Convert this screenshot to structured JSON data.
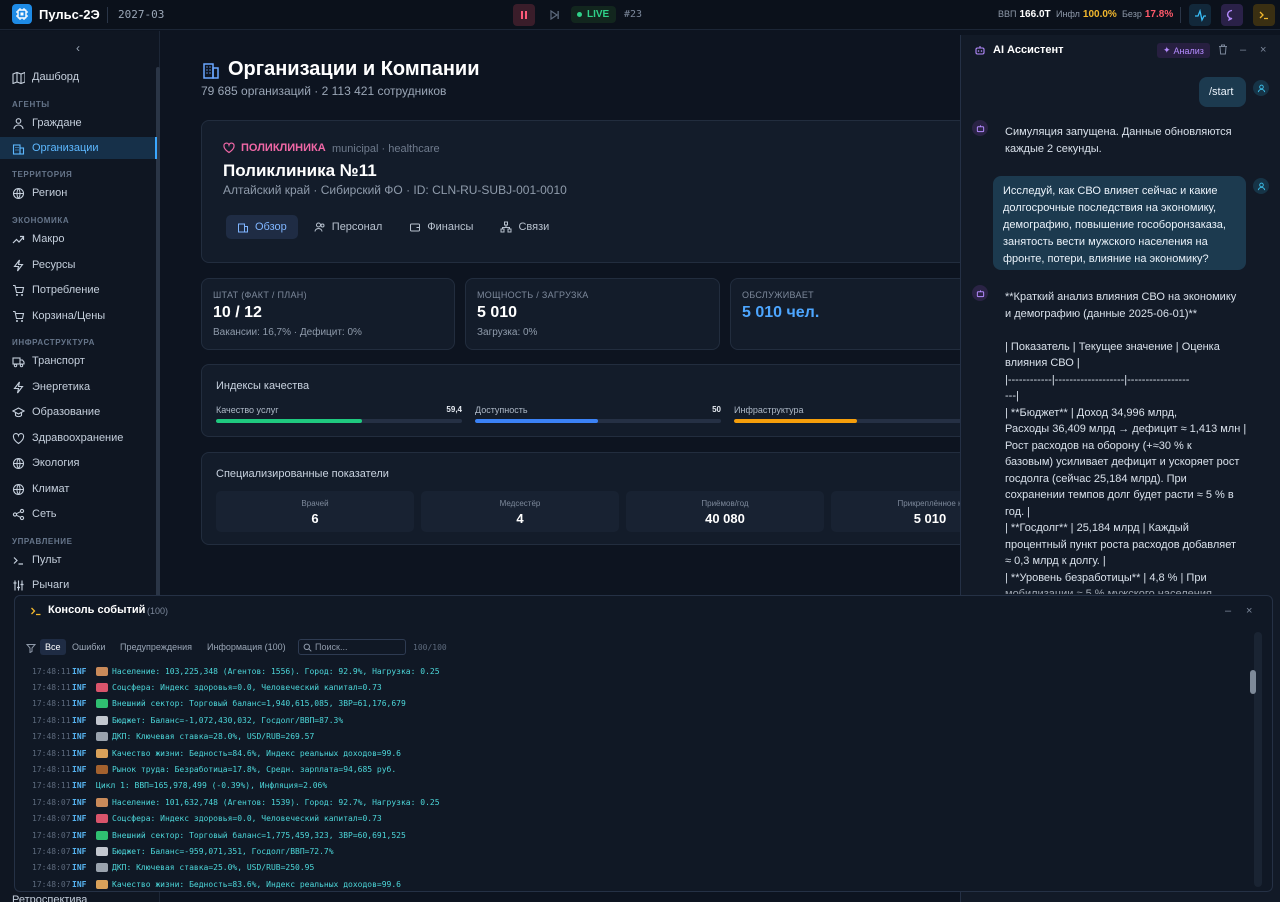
{
  "topbar": {
    "app_title": "Пульс-2Э",
    "date": "2027-03",
    "live": "LIVE",
    "tick": "#23",
    "kpis": [
      {
        "label": "ВВП",
        "value": "166.0T",
        "color": "#ffffff"
      },
      {
        "label": "Инфл",
        "value": "100.0%",
        "color": "#f3b82d"
      },
      {
        "label": "Безр",
        "value": "17.8%",
        "color": "#ff5a6a"
      }
    ]
  },
  "sidebar": {
    "items": [
      {
        "type": "item",
        "label": "Дашборд",
        "icon": "map-icon"
      },
      {
        "type": "section",
        "label": "АГЕНТЫ"
      },
      {
        "type": "item",
        "label": "Граждане",
        "icon": "user-icon"
      },
      {
        "type": "item",
        "label": "Организации",
        "icon": "building-icon",
        "active": true
      },
      {
        "type": "section",
        "label": "ТЕРРИТОРИЯ"
      },
      {
        "type": "item",
        "label": "Регион",
        "icon": "globe-icon"
      },
      {
        "type": "section",
        "label": "ЭКОНОМИКА"
      },
      {
        "type": "item",
        "label": "Макро",
        "icon": "trend-icon"
      },
      {
        "type": "item",
        "label": "Ресурсы",
        "icon": "bolt-icon"
      },
      {
        "type": "item",
        "label": "Потребление",
        "icon": "cart-icon"
      },
      {
        "type": "item",
        "label": "Корзина/Цены",
        "icon": "cart-icon"
      },
      {
        "type": "section",
        "label": "ИНФРАСТРУКТУРА"
      },
      {
        "type": "item",
        "label": "Транспорт",
        "icon": "truck-icon"
      },
      {
        "type": "item",
        "label": "Энергетика",
        "icon": "bolt-icon"
      },
      {
        "type": "item",
        "label": "Образование",
        "icon": "cap-icon"
      },
      {
        "type": "item",
        "label": "Здравоохранение",
        "icon": "heart-icon"
      },
      {
        "type": "item",
        "label": "Экология",
        "icon": "globe-icon"
      },
      {
        "type": "item",
        "label": "Климат",
        "icon": "globe-icon"
      },
      {
        "type": "item",
        "label": "Сеть",
        "icon": "share-icon"
      },
      {
        "type": "section",
        "label": "УПРАВЛЕНИЕ"
      },
      {
        "type": "item",
        "label": "Пульт",
        "icon": "terminal-icon"
      },
      {
        "type": "item",
        "label": "Рычаги",
        "icon": "sliders-icon"
      }
    ],
    "bottom_item": "Ретроспектива"
  },
  "main": {
    "title": "Организации и Компании",
    "subtitle": "79 685 организаций · 2 113 421 сотрудников",
    "org": {
      "type": "ПОЛИКЛИНИКА",
      "tags": "municipal · healthcare",
      "name": "Поликлиника №11",
      "meta": "Алтайский край · Сибирский ФО · ID: CLN-RU-SUBJ-001-0010",
      "tabs": [
        {
          "label": "Обзор",
          "icon": "building-icon",
          "active": true
        },
        {
          "label": "Персонал",
          "icon": "users-icon"
        },
        {
          "label": "Финансы",
          "icon": "wallet-icon"
        },
        {
          "label": "Связи",
          "icon": "network-icon"
        }
      ]
    },
    "stats": [
      {
        "label": "ШТАТ (ФАКТ / ПЛАН)",
        "value": "10 / 12",
        "sub": "Вакансии: 16,7% · Дефицит: 0%",
        "color": "#ffffff"
      },
      {
        "label": "МОЩНОСТЬ / ЗАГРУЗКА",
        "value": "5 010",
        "sub": "Загрузка: 0%",
        "color": "#ffffff"
      },
      {
        "label": "ОБСЛУЖИВАЕТ",
        "value": "5 010 чел.",
        "sub": "",
        "color": "#4da6ff"
      }
    ],
    "quality": {
      "title": "Индексы качества",
      "items": [
        {
          "label": "Качество услуг",
          "value": "59,4",
          "fraction": 0.594,
          "color": "#1fc97f"
        },
        {
          "label": "Доступность",
          "value": "50",
          "fraction": 0.5,
          "color": "#3b82f6"
        },
        {
          "label": "Инфраструктура",
          "value": "",
          "fraction": 0.5,
          "color": "#f59e0b"
        }
      ]
    },
    "special": {
      "title": "Специализированные показатели",
      "items": [
        {
          "label": "Врачей",
          "value": "6"
        },
        {
          "label": "Медсестёр",
          "value": "4"
        },
        {
          "label": "Приёмов/год",
          "value": "40 080"
        },
        {
          "label": "Прикреплённое н",
          "value": "5 010"
        }
      ]
    }
  },
  "ai": {
    "title": "AI Ассистент",
    "analyze": "Анализ",
    "messages": [
      {
        "role": "user",
        "text": "/start"
      },
      {
        "role": "bot",
        "text": "Симуляция запущена. Данные обновляются\nкаждые 2 секунды."
      },
      {
        "role": "user",
        "text": "Исследуй, как СВО влияет сейчас и какие\nдолгосрочные последствия на экономику,\nдемографию, повышение гособоронзаказа,\nзанятость вести мужского населения на\nфронте, потери, влияние на экономику?"
      },
      {
        "role": "bot",
        "text": "**Краткий анализ влияния СВО на экономику\nи демографию (данные 2025-06-01)**\n\n| Показатель | Текущее значение | Оценка\nвлияния СВО |\n|------------|-------------------|-----------------\n---|\n| **Бюджет** | Доход 34,996 млрд,\nРасходы 36,409 млрд → дефицит ≈ 1,413 млн |\nРост расходов на оборону (+≈30 % к\nбазовым) усиливает дефицит и ускоряет рост\nгосдолга (сейчас 25,184 млрд). При\nсохранении темпов долг будет расти ≈ 5 % в\nгод. |\n| **Госдолг** | 25,184 млрд | Каждый\nпроцентный пункт роста расходов добавляет\n≈ 0,3 млрд к долгу. |\n| **Уровень безработицы** | 4,8 % | При\nмобилизации ≈ 5 % мужского населения"
      }
    ]
  },
  "console": {
    "title": "Консоль событий",
    "count": "(100)",
    "filters": [
      {
        "label": "Все",
        "active": true
      },
      {
        "label": "Ошибки"
      },
      {
        "label": "Предупреждения"
      },
      {
        "label": "Информация (100)"
      }
    ],
    "search_placeholder": "Поиск...",
    "pages": "100/100",
    "logs": [
      {
        "time": "17:48:11",
        "level": "INF",
        "emoji": "#c98a5a",
        "msg": "Население: 103,225,348 (Агентов: 1556). Город: 92.9%, Нагрузка: 0.25"
      },
      {
        "time": "17:48:11",
        "level": "INF",
        "emoji": "#d9546b",
        "msg": "Соцсфера: Индекс здоровья=0.0, Человеческий капитал=0.73"
      },
      {
        "time": "17:48:11",
        "level": "INF",
        "emoji": "#2fbf71",
        "msg": "Внешний сектор: Торговый баланс=1,940,615,085, ЗВР=61,176,679"
      },
      {
        "time": "17:48:11",
        "level": "INF",
        "emoji": "#c2c7cf",
        "msg": "Бюджет: Баланс=-1,072,430,032, Госдолг/ВВП=87.3%"
      },
      {
        "time": "17:48:11",
        "level": "INF",
        "emoji": "#9aa3ae",
        "msg": "ДКП: Ключевая ставка=28.0%, USD/RUB=269.57"
      },
      {
        "time": "17:48:11",
        "level": "INF",
        "emoji": "#d9a15a",
        "msg": "Качество жизни: Бедность=84.6%, Индекс реальных доходов=99.6"
      },
      {
        "time": "17:48:11",
        "level": "INF",
        "emoji": "#a3612e",
        "msg": "Рынок труда: Безработица=17.8%, Средн. зарплата=94,685 руб."
      },
      {
        "time": "17:48:11",
        "level": "INF",
        "emoji": "",
        "msg": "Цикл 1: ВВП=165,978,499 (-0.39%), Инфляция=2.06%"
      },
      {
        "time": "17:48:07",
        "level": "INF",
        "emoji": "#c98a5a",
        "msg": "Население: 101,632,748 (Агентов: 1539). Город: 92.7%, Нагрузка: 0.25"
      },
      {
        "time": "17:48:07",
        "level": "INF",
        "emoji": "#d9546b",
        "msg": "Соцсфера: Индекс здоровья=0.0, Человеческий капитал=0.73"
      },
      {
        "time": "17:48:07",
        "level": "INF",
        "emoji": "#2fbf71",
        "msg": "Внешний сектор: Торговый баланс=1,775,459,323, ЗВР=60,691,525"
      },
      {
        "time": "17:48:07",
        "level": "INF",
        "emoji": "#c2c7cf",
        "msg": "Бюджет: Баланс=-959,071,351, Госдолг/ВВП=72.7%"
      },
      {
        "time": "17:48:07",
        "level": "INF",
        "emoji": "#9aa3ae",
        "msg": "ДКП: Ключевая ставка=25.0%, USD/RUB=250.95"
      },
      {
        "time": "17:48:07",
        "level": "INF",
        "emoji": "#d9a15a",
        "msg": "Качество жизни: Бедность=83.6%, Индекс реальных доходов=99.6"
      }
    ]
  }
}
